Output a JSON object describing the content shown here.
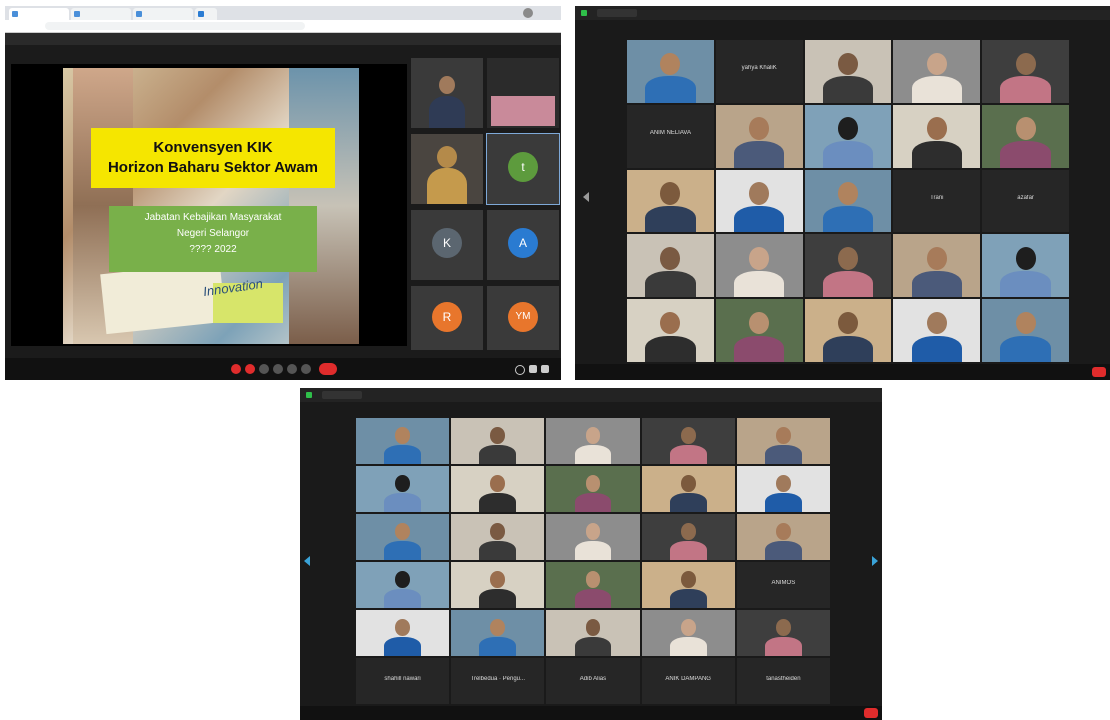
{
  "shot1": {
    "tabs": [
      "",
      "",
      "",
      ""
    ],
    "meeting_title": "",
    "slide": {
      "title_line1": "Konvensyen KIK",
      "title_line2": "Horizon Baharu Sektor Awam",
      "sub_line1": "Jabatan Kebajikan Masyarakat",
      "sub_line2": "Negeri Selangor",
      "sub_line3": "???? 2022",
      "innovation_word": "Innovation"
    },
    "gallery": [
      {
        "initial": "",
        "name": ""
      },
      {
        "initial": "",
        "name": ""
      },
      {
        "initial": "",
        "name": ""
      },
      {
        "initial": "t",
        "name": "",
        "color": "#5d9b3d"
      },
      {
        "initial": "K",
        "name": "",
        "color": "#5b6670"
      },
      {
        "initial": "A",
        "name": "",
        "color": "#2a7bd1"
      },
      {
        "initial": "R",
        "name": "",
        "color": "#e8762c"
      },
      {
        "initial": "YM",
        "name": "",
        "color": "#e8762c"
      }
    ]
  },
  "shot2": {
    "text_tiles": [
      "yahya KhaliK",
      "ANIM NELIAVA",
      "Trani",
      "azafar"
    ]
  },
  "shot3": {
    "text_tiles": [
      "ANIMOS",
      "shahill nawari",
      "Trelbedua · Pengu...",
      "Adib Alias",
      "ANIK DAMPANG",
      "tanastheiden"
    ]
  },
  "colors": {
    "zoom_red": "#e02c2c",
    "zoom_green": "#2fbf4a",
    "tile_bg": "#2b2b2b",
    "active_speaker": "#d4d400"
  }
}
